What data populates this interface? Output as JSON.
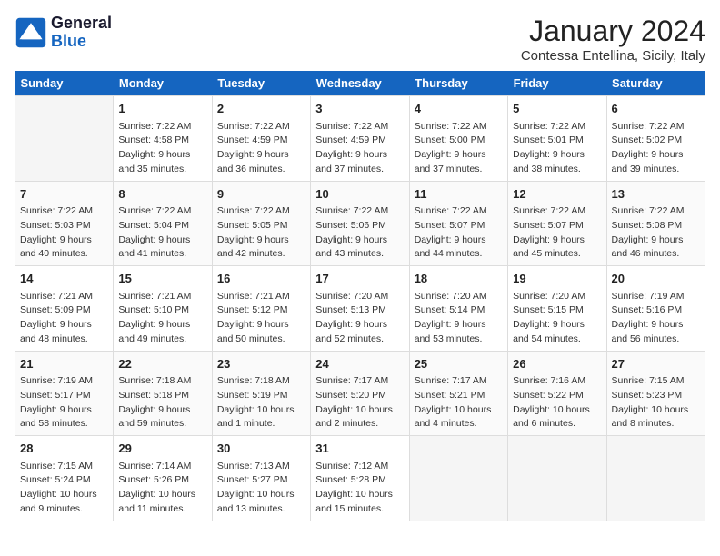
{
  "header": {
    "logo_line1": "General",
    "logo_line2": "Blue",
    "month_title": "January 2024",
    "location": "Contessa Entellina, Sicily, Italy"
  },
  "weekdays": [
    "Sunday",
    "Monday",
    "Tuesday",
    "Wednesday",
    "Thursday",
    "Friday",
    "Saturday"
  ],
  "weeks": [
    [
      {
        "day": "",
        "info": ""
      },
      {
        "day": "1",
        "info": "Sunrise: 7:22 AM\nSunset: 4:58 PM\nDaylight: 9 hours\nand 35 minutes."
      },
      {
        "day": "2",
        "info": "Sunrise: 7:22 AM\nSunset: 4:59 PM\nDaylight: 9 hours\nand 36 minutes."
      },
      {
        "day": "3",
        "info": "Sunrise: 7:22 AM\nSunset: 4:59 PM\nDaylight: 9 hours\nand 37 minutes."
      },
      {
        "day": "4",
        "info": "Sunrise: 7:22 AM\nSunset: 5:00 PM\nDaylight: 9 hours\nand 37 minutes."
      },
      {
        "day": "5",
        "info": "Sunrise: 7:22 AM\nSunset: 5:01 PM\nDaylight: 9 hours\nand 38 minutes."
      },
      {
        "day": "6",
        "info": "Sunrise: 7:22 AM\nSunset: 5:02 PM\nDaylight: 9 hours\nand 39 minutes."
      }
    ],
    [
      {
        "day": "7",
        "info": "Sunrise: 7:22 AM\nSunset: 5:03 PM\nDaylight: 9 hours\nand 40 minutes."
      },
      {
        "day": "8",
        "info": "Sunrise: 7:22 AM\nSunset: 5:04 PM\nDaylight: 9 hours\nand 41 minutes."
      },
      {
        "day": "9",
        "info": "Sunrise: 7:22 AM\nSunset: 5:05 PM\nDaylight: 9 hours\nand 42 minutes."
      },
      {
        "day": "10",
        "info": "Sunrise: 7:22 AM\nSunset: 5:06 PM\nDaylight: 9 hours\nand 43 minutes."
      },
      {
        "day": "11",
        "info": "Sunrise: 7:22 AM\nSunset: 5:07 PM\nDaylight: 9 hours\nand 44 minutes."
      },
      {
        "day": "12",
        "info": "Sunrise: 7:22 AM\nSunset: 5:07 PM\nDaylight: 9 hours\nand 45 minutes."
      },
      {
        "day": "13",
        "info": "Sunrise: 7:22 AM\nSunset: 5:08 PM\nDaylight: 9 hours\nand 46 minutes."
      }
    ],
    [
      {
        "day": "14",
        "info": "Sunrise: 7:21 AM\nSunset: 5:09 PM\nDaylight: 9 hours\nand 48 minutes."
      },
      {
        "day": "15",
        "info": "Sunrise: 7:21 AM\nSunset: 5:10 PM\nDaylight: 9 hours\nand 49 minutes."
      },
      {
        "day": "16",
        "info": "Sunrise: 7:21 AM\nSunset: 5:12 PM\nDaylight: 9 hours\nand 50 minutes."
      },
      {
        "day": "17",
        "info": "Sunrise: 7:20 AM\nSunset: 5:13 PM\nDaylight: 9 hours\nand 52 minutes."
      },
      {
        "day": "18",
        "info": "Sunrise: 7:20 AM\nSunset: 5:14 PM\nDaylight: 9 hours\nand 53 minutes."
      },
      {
        "day": "19",
        "info": "Sunrise: 7:20 AM\nSunset: 5:15 PM\nDaylight: 9 hours\nand 54 minutes."
      },
      {
        "day": "20",
        "info": "Sunrise: 7:19 AM\nSunset: 5:16 PM\nDaylight: 9 hours\nand 56 minutes."
      }
    ],
    [
      {
        "day": "21",
        "info": "Sunrise: 7:19 AM\nSunset: 5:17 PM\nDaylight: 9 hours\nand 58 minutes."
      },
      {
        "day": "22",
        "info": "Sunrise: 7:18 AM\nSunset: 5:18 PM\nDaylight: 9 hours\nand 59 minutes."
      },
      {
        "day": "23",
        "info": "Sunrise: 7:18 AM\nSunset: 5:19 PM\nDaylight: 10 hours\nand 1 minute."
      },
      {
        "day": "24",
        "info": "Sunrise: 7:17 AM\nSunset: 5:20 PM\nDaylight: 10 hours\nand 2 minutes."
      },
      {
        "day": "25",
        "info": "Sunrise: 7:17 AM\nSunset: 5:21 PM\nDaylight: 10 hours\nand 4 minutes."
      },
      {
        "day": "26",
        "info": "Sunrise: 7:16 AM\nSunset: 5:22 PM\nDaylight: 10 hours\nand 6 minutes."
      },
      {
        "day": "27",
        "info": "Sunrise: 7:15 AM\nSunset: 5:23 PM\nDaylight: 10 hours\nand 8 minutes."
      }
    ],
    [
      {
        "day": "28",
        "info": "Sunrise: 7:15 AM\nSunset: 5:24 PM\nDaylight: 10 hours\nand 9 minutes."
      },
      {
        "day": "29",
        "info": "Sunrise: 7:14 AM\nSunset: 5:26 PM\nDaylight: 10 hours\nand 11 minutes."
      },
      {
        "day": "30",
        "info": "Sunrise: 7:13 AM\nSunset: 5:27 PM\nDaylight: 10 hours\nand 13 minutes."
      },
      {
        "day": "31",
        "info": "Sunrise: 7:12 AM\nSunset: 5:28 PM\nDaylight: 10 hours\nand 15 minutes."
      },
      {
        "day": "",
        "info": ""
      },
      {
        "day": "",
        "info": ""
      },
      {
        "day": "",
        "info": ""
      }
    ]
  ]
}
